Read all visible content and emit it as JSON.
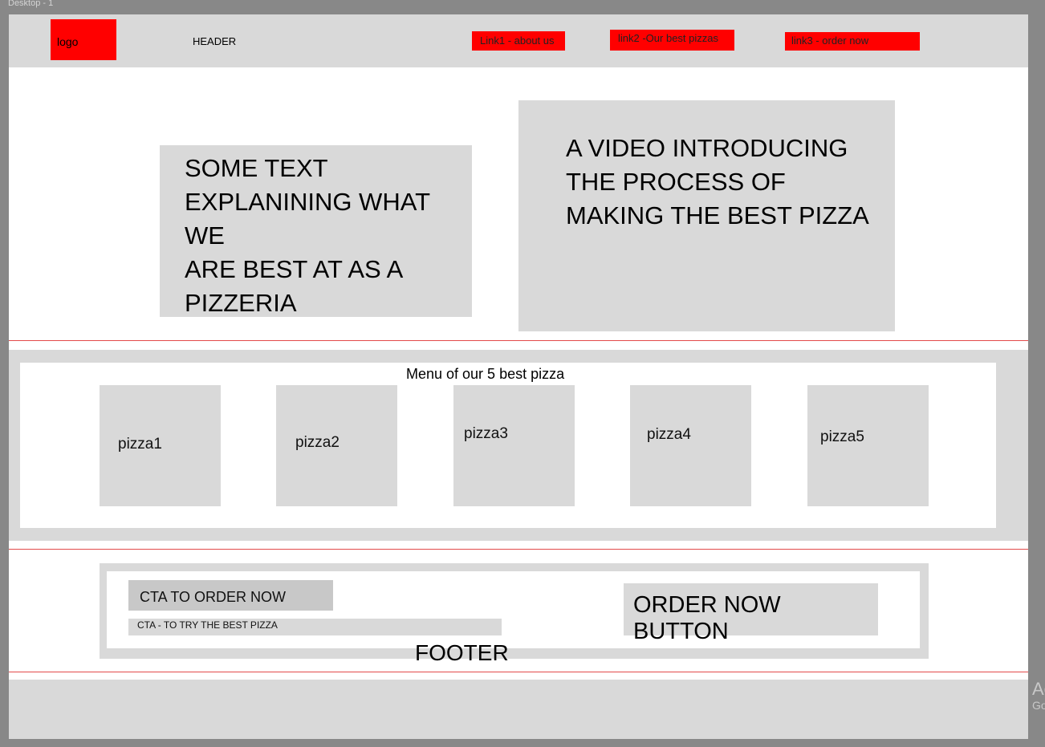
{
  "frame": {
    "label": "Desktop - 1"
  },
  "header": {
    "logo": "logo",
    "title": "HEADER",
    "links": [
      "Link1 - about us",
      "link2 -Our best pizzas",
      "link3 - order now"
    ]
  },
  "hero": {
    "text_lines": [
      "SOME TEXT",
      "EXPLANINING WHAT WE",
      "ARE BEST AT AS A",
      "PIZZERIA"
    ],
    "video_lines": [
      "A VIDEO INTRODUCING",
      "THE PROCESS OF",
      "MAKING THE BEST PIZZA"
    ]
  },
  "menu": {
    "title": "Menu of our 5 best pizza",
    "items": [
      "pizza1",
      "pizza2",
      "pizza3",
      "pizza4",
      "pizza5"
    ]
  },
  "cta": {
    "headline": "CTA TO ORDER NOW",
    "subline": "CTA - TO TRY THE BEST PIZZA",
    "button": "ORDER NOW BUTTON"
  },
  "footer": {
    "label": "FOOTER"
  },
  "watermark": {
    "line1": "Ac",
    "line2": "Go"
  },
  "colors": {
    "accent": "#ff0000",
    "panel": "#d9d9d9",
    "divider": "#e34a4a",
    "workspace": "#888888"
  }
}
